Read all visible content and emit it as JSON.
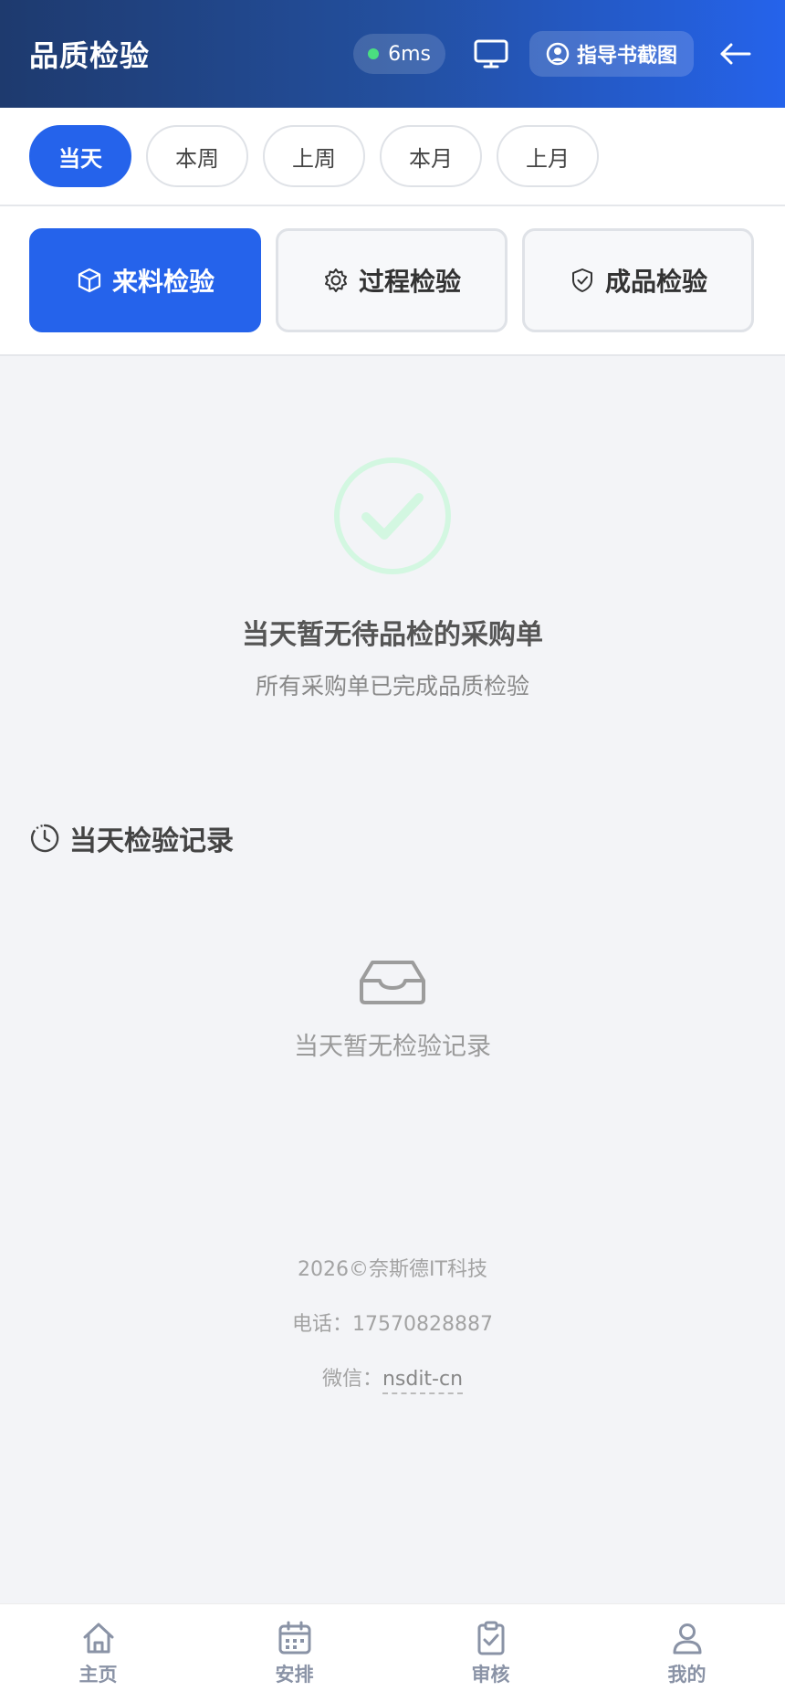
{
  "header": {
    "title": "品质检验",
    "latency": "6ms",
    "guide_label": "指导书截图"
  },
  "date_tabs": [
    {
      "label": "当天",
      "active": true
    },
    {
      "label": "本周",
      "active": false
    },
    {
      "label": "上周",
      "active": false
    },
    {
      "label": "本月",
      "active": false
    },
    {
      "label": "上月",
      "active": false
    }
  ],
  "category_tabs": [
    {
      "label": "来料检验",
      "icon": "box-icon",
      "active": true
    },
    {
      "label": "过程检验",
      "icon": "gear-icon",
      "active": false
    },
    {
      "label": "成品检验",
      "icon": "shield-check-icon",
      "active": false
    }
  ],
  "empty_pending": {
    "main": "当天暂无待品检的采购单",
    "sub": "所有采购单已完成品质检验"
  },
  "records": {
    "title": "当天检验记录",
    "empty": "当天暂无检验记录"
  },
  "footer": {
    "copyright": "2026©奈斯德IT科技",
    "phone": "电话：17570828887",
    "wechat_label": "微信：",
    "wechat_id": "nsdit-cn"
  },
  "bottom_nav": [
    {
      "label": "主页",
      "icon": "home-icon"
    },
    {
      "label": "安排",
      "icon": "calendar-icon"
    },
    {
      "label": "审核",
      "icon": "clipboard-check-icon"
    },
    {
      "label": "我的",
      "icon": "user-icon"
    }
  ],
  "colors": {
    "primary": "#2563eb",
    "header_start": "#1e3a6e",
    "success": "#4ade80"
  }
}
